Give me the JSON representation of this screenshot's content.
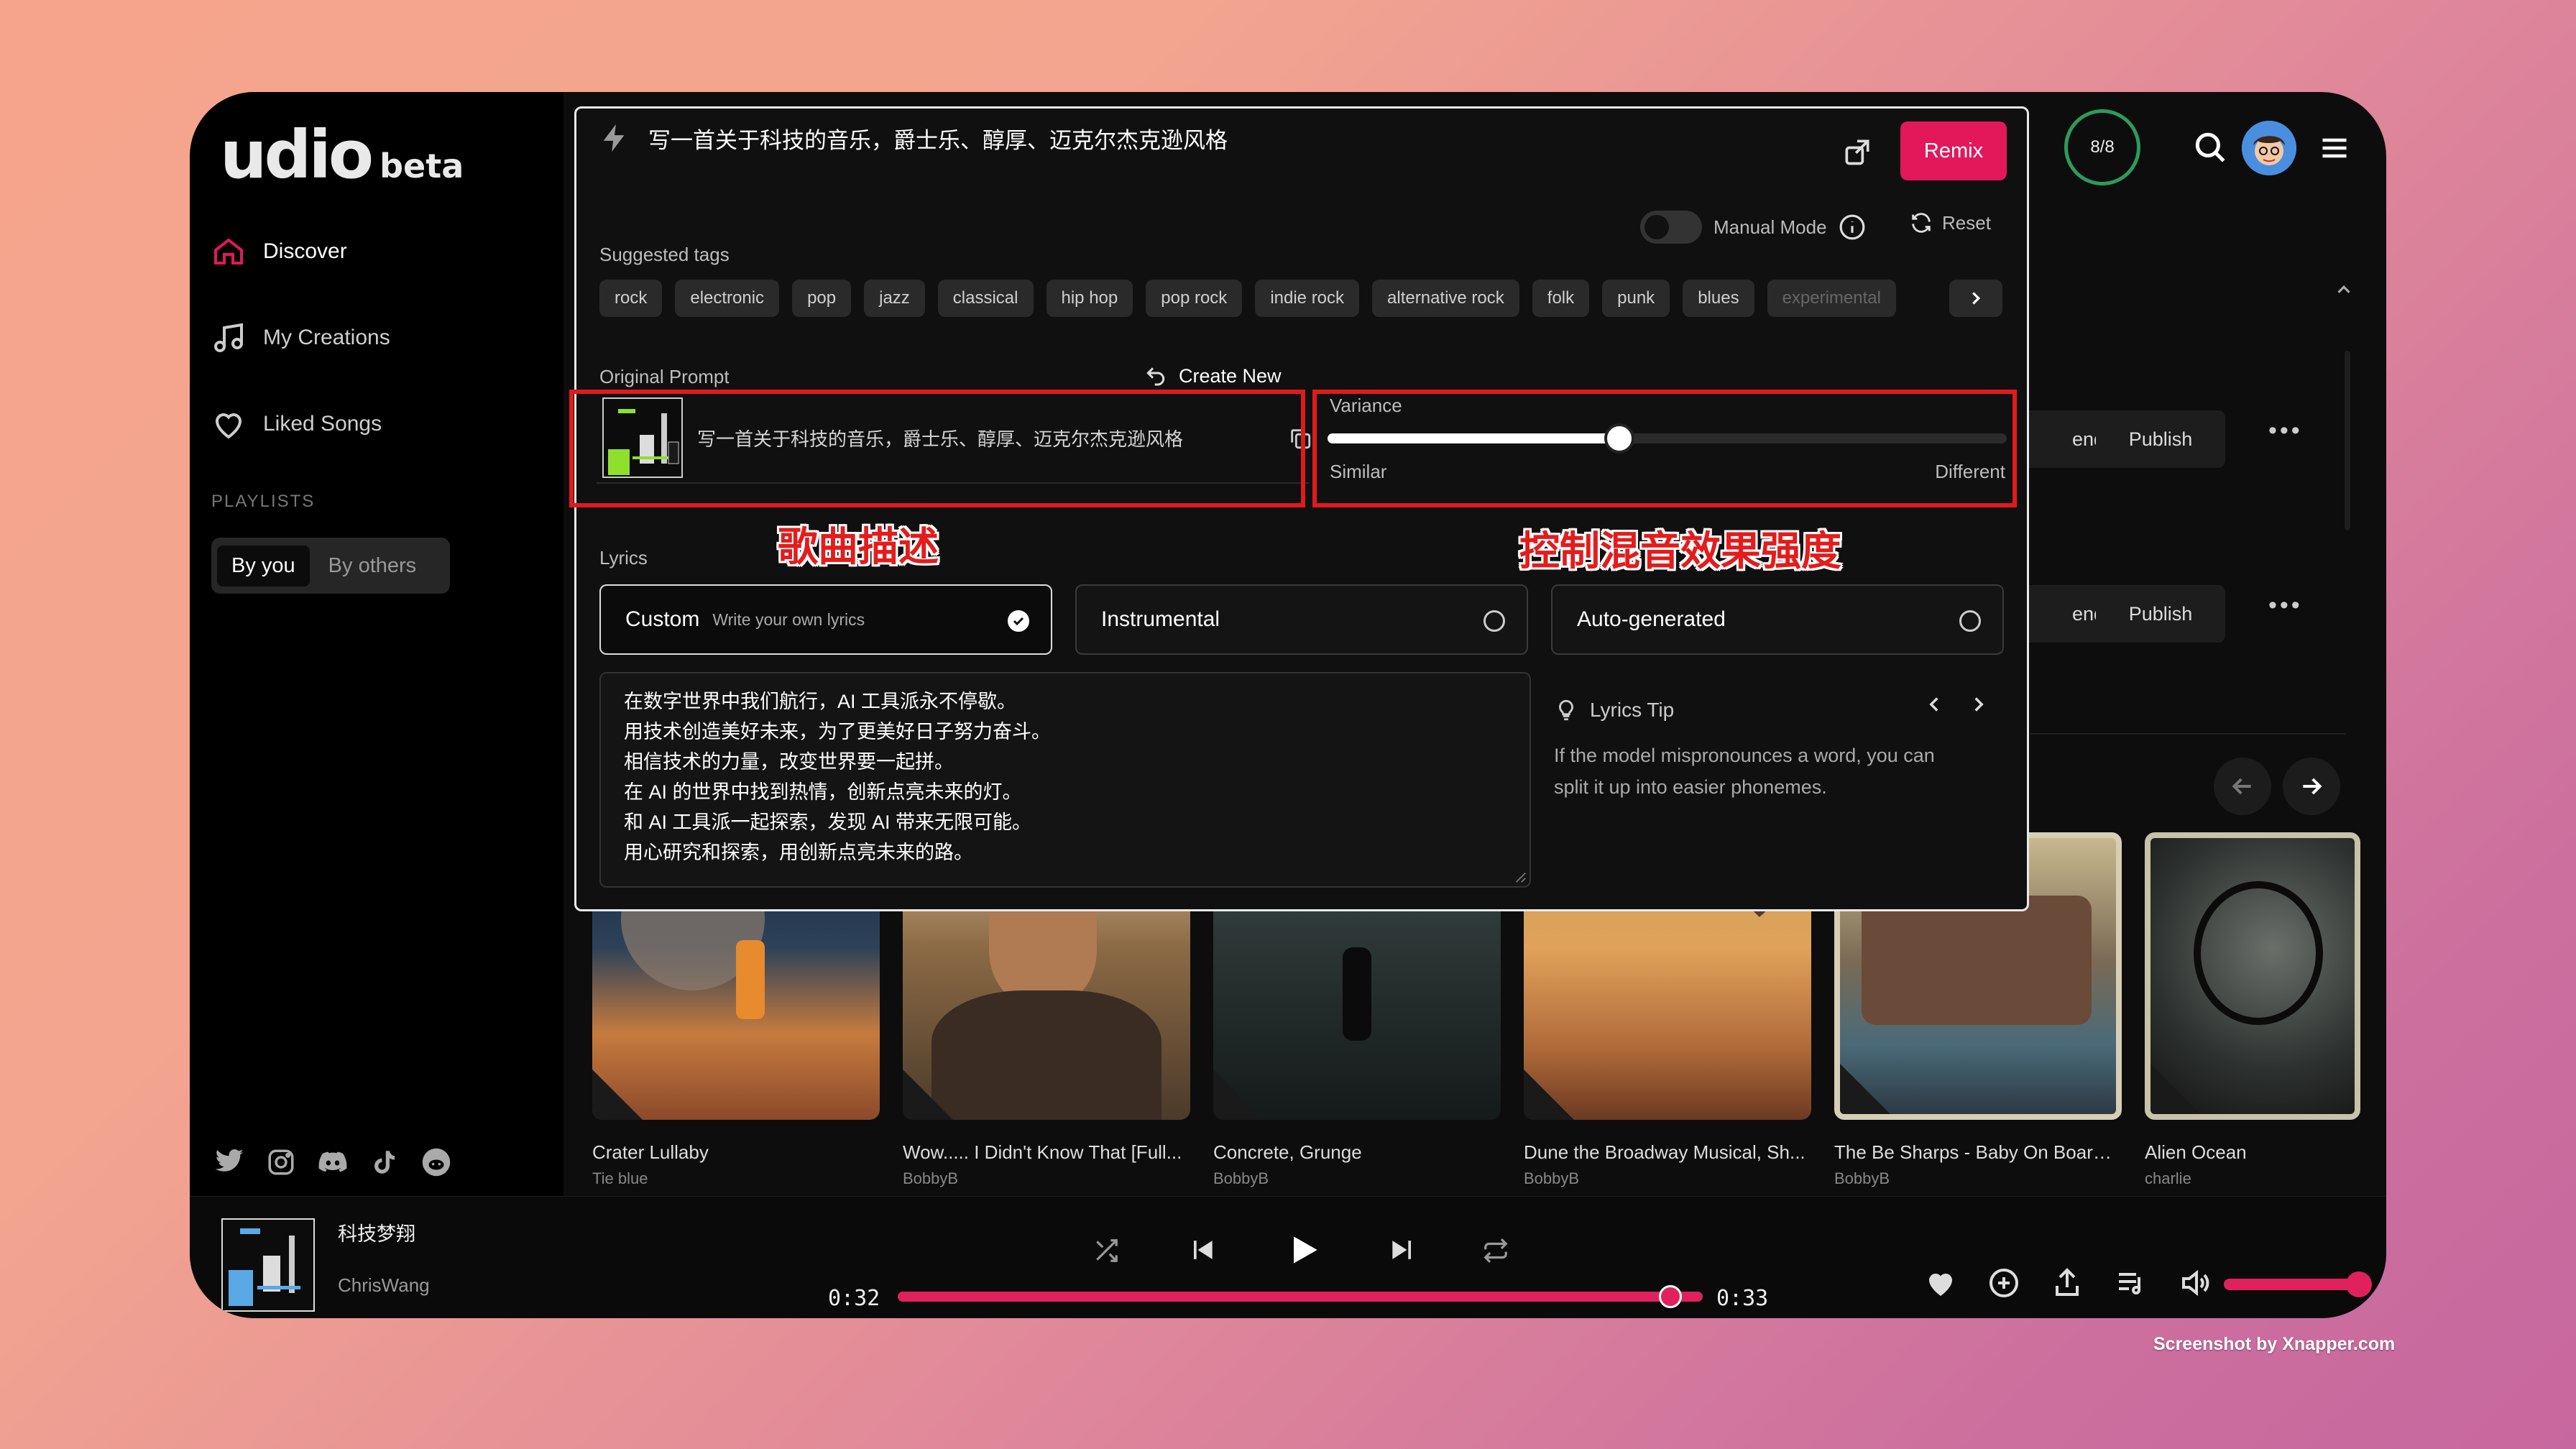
{
  "app": {
    "logo": "udio",
    "logo_badge": "beta"
  },
  "sidebar": {
    "items": [
      {
        "label": "Discover",
        "icon": "home-icon"
      },
      {
        "label": "My Creations",
        "icon": "music-note-icon"
      },
      {
        "label": "Liked Songs",
        "icon": "heart-icon"
      }
    ],
    "playlists_heading": "PLAYLISTS",
    "segment": {
      "by_you": "By you",
      "by_others": "By others"
    },
    "social": [
      "twitter-icon",
      "instagram-icon",
      "discord-icon",
      "tiktok-icon",
      "reddit-icon"
    ]
  },
  "header": {
    "credits": "8/8"
  },
  "remix_panel": {
    "prompt": "写一首关于科技的音乐，爵士乐、醇厚、迈克尔杰克逊风格",
    "remix_label": "Remix",
    "manual_mode_label": "Manual Mode",
    "reset_label": "Reset",
    "suggested_tags_label": "Suggested tags",
    "tags": [
      "rock",
      "electronic",
      "pop",
      "jazz",
      "classical",
      "hip hop",
      "pop rock",
      "indie rock",
      "alternative rock",
      "folk",
      "punk",
      "blues",
      "experimental"
    ],
    "original_prompt_label": "Original Prompt",
    "create_new_label": "Create New",
    "original_prompt_text": "写一首关于科技的音乐，爵士乐、醇厚、迈克尔杰克逊风格",
    "variance": {
      "label": "Variance",
      "min_label": "Similar",
      "max_label": "Different",
      "value": 0.43
    },
    "annotations": {
      "left": "歌曲描述",
      "right": "控制混音效果强度"
    },
    "lyrics_label": "Lyrics",
    "lyrics_options": {
      "custom": "Custom",
      "custom_sub": "Write your own lyrics",
      "instrumental": "Instrumental",
      "auto": "Auto-generated"
    },
    "lyrics_lines": [
      "在数字世界中我们航行，AI 工具派永不停歇。",
      "用技术创造美好未来，为了更美好日子努力奋斗。",
      "相信技术的力量，改变世界要一起拼。",
      "在 AI 的世界中找到热情，创新点亮未来的灯。",
      "和 AI 工具派一起探索，发现 AI 带来无限可能。",
      "用心研究和探索，用创新点亮未来的路。"
    ],
    "tip": {
      "title": "Lyrics Tip",
      "text": "If the model mispronounces a word, you can split it up into easier phonemes."
    }
  },
  "background_list": {
    "row_buttons": {
      "partial": "end",
      "publish": "Publish"
    }
  },
  "cards": [
    {
      "title": "Crater Lullaby",
      "artist": "Tie blue"
    },
    {
      "title": "Wow..... I Didn't Know That [Full...",
      "artist": "BobbyB"
    },
    {
      "title": "Concrete, Grunge",
      "artist": "BobbyB"
    },
    {
      "title": "Dune the Broadway Musical, Sh...",
      "artist": "BobbyB"
    },
    {
      "title": "The Be Sharps - Baby On Board,...",
      "artist": "BobbyB"
    },
    {
      "title": "Alien Ocean",
      "artist": "charlie"
    }
  ],
  "player": {
    "title": "科技梦翔",
    "artist": "ChrisWang",
    "elapsed": "0:32",
    "duration": "0:33",
    "progress": 0.96,
    "volume": 1.0
  },
  "watermark": "Screenshot by Xnapper.com",
  "colors": {
    "accent": "#e2185b",
    "annotation": "#e11a1a",
    "credits_ring": "#2d9b5b"
  }
}
